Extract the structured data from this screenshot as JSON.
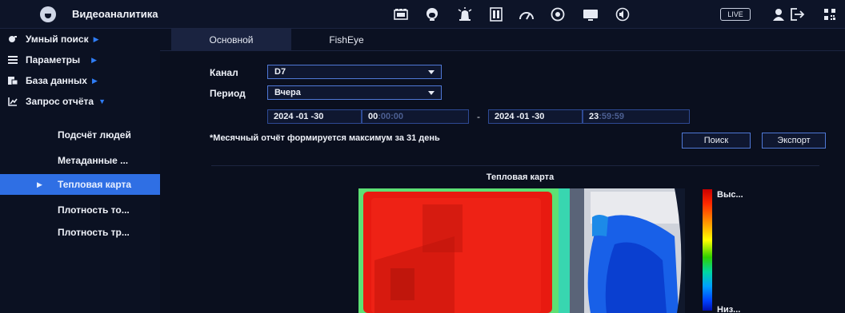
{
  "app": {
    "title": "Видеоаналитика",
    "live_label": "LIVE"
  },
  "toolbar_icons": [
    "film-icon",
    "face-icon",
    "alarm-icon",
    "storage-icon",
    "gauge-icon",
    "record-icon",
    "monitor-icon",
    "audio-icon"
  ],
  "sidebar": {
    "items": [
      {
        "label": "Умный поиск",
        "icon": "smart-search-icon"
      },
      {
        "label": "Параметры",
        "icon": "list-icon"
      },
      {
        "label": "База данных",
        "icon": "database-icon"
      },
      {
        "label": "Запрос отчёта",
        "icon": "chart-icon"
      }
    ],
    "subitems": [
      {
        "label": "Подсчёт людей"
      },
      {
        "label": "Метаданные ..."
      },
      {
        "label": "Тепловая карта",
        "active": true
      },
      {
        "label": "Плотность то..."
      },
      {
        "label": "Плотность тр..."
      }
    ]
  },
  "tabs": [
    {
      "label": "Основной",
      "active": true
    },
    {
      "label": "FishEye",
      "active": false
    }
  ],
  "form": {
    "channel_label": "Канал",
    "channel_value": "D7",
    "period_label": "Период",
    "period_value": "Вчера",
    "start_date": "2024 -01 -30",
    "start_time_hh": "00",
    "start_time_rest": ":00:00",
    "end_date": "2024 -01 -30",
    "end_time_hh": "23",
    "end_time_rest": ":59:59",
    "range_separator": "-",
    "note": "*Месячный отчёт формируется максимум за 31 день",
    "search_button": "Поиск",
    "export_button": "Экспорт"
  },
  "heatmap": {
    "title": "Тепловая карта",
    "legend_high": "Выс...",
    "legend_low": "Низ..."
  },
  "colors": {
    "accent": "#2f6fe4",
    "border": "#4f78d6",
    "background": "#0a0f1e"
  }
}
